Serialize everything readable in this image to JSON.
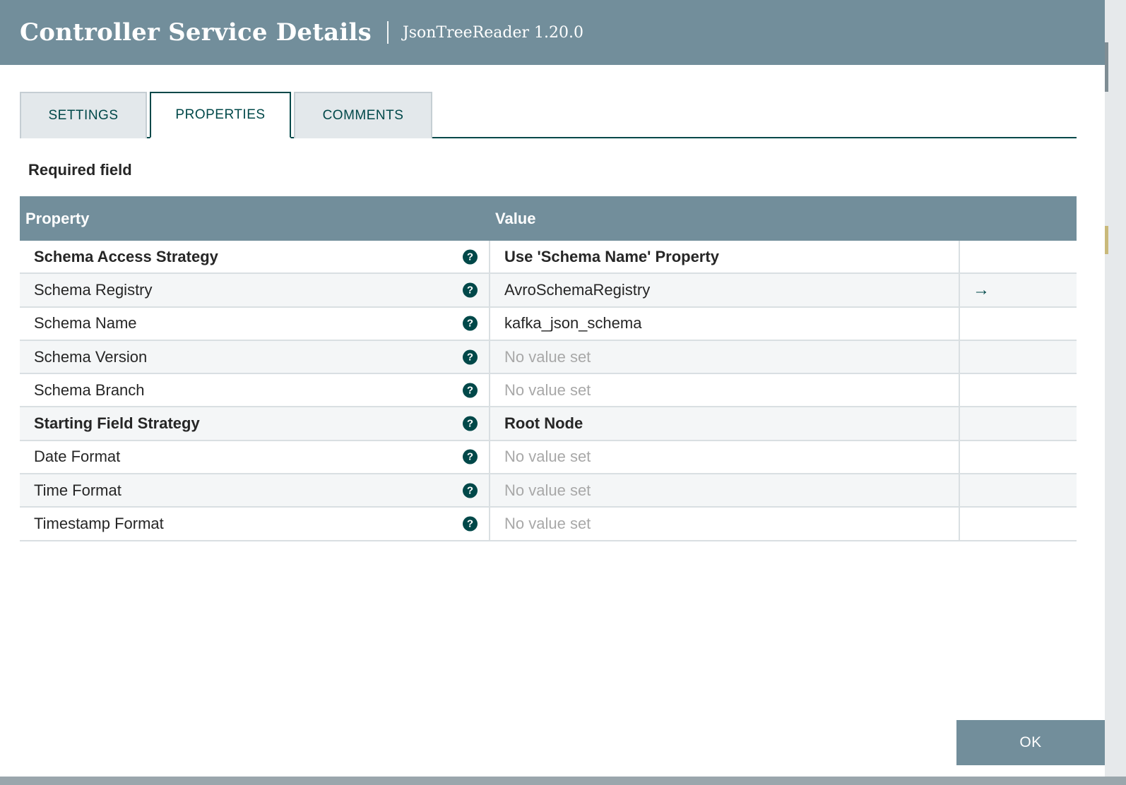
{
  "header": {
    "title": "Controller Service Details",
    "subtitle": "JsonTreeReader 1.20.0"
  },
  "tabs": [
    {
      "label": "SETTINGS",
      "active": false
    },
    {
      "label": "PROPERTIES",
      "active": true
    },
    {
      "label": "COMMENTS",
      "active": false
    }
  ],
  "required_label": "Required field",
  "table": {
    "columns": [
      "Property",
      "Value"
    ],
    "rows": [
      {
        "name": "Schema Access Strategy",
        "value": "Use 'Schema Name' Property",
        "required": true,
        "empty": false,
        "action": ""
      },
      {
        "name": "Schema Registry",
        "value": "AvroSchemaRegistry",
        "required": false,
        "empty": false,
        "action": "arrow-right"
      },
      {
        "name": "Schema Name",
        "value": "kafka_json_schema",
        "required": false,
        "empty": false,
        "action": ""
      },
      {
        "name": "Schema Version",
        "value": "No value set",
        "required": false,
        "empty": true,
        "action": ""
      },
      {
        "name": "Schema Branch",
        "value": "No value set",
        "required": false,
        "empty": true,
        "action": ""
      },
      {
        "name": "Starting Field Strategy",
        "value": "Root Node",
        "required": true,
        "empty": false,
        "action": ""
      },
      {
        "name": "Date Format",
        "value": "No value set",
        "required": false,
        "empty": true,
        "action": ""
      },
      {
        "name": "Time Format",
        "value": "No value set",
        "required": false,
        "empty": true,
        "action": ""
      },
      {
        "name": "Timestamp Format",
        "value": "No value set",
        "required": false,
        "empty": true,
        "action": ""
      }
    ]
  },
  "ok_label": "OK",
  "colors": {
    "header_bg": "#728e9b",
    "accent": "#004849",
    "empty_text": "#a8a8a8"
  }
}
